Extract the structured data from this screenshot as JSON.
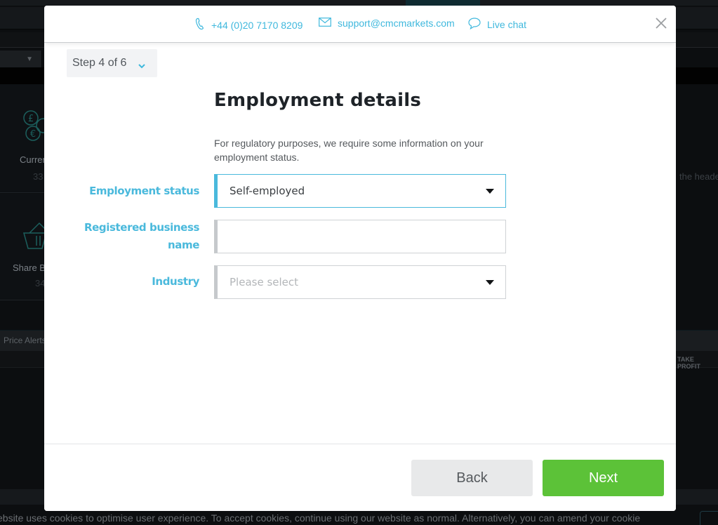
{
  "background": {
    "tiles": [
      {
        "icon": "currency-coins-icon",
        "label": "Curren",
        "count": "33"
      },
      {
        "icon": "share-basket-icon",
        "label": "Share Ba",
        "count": "34"
      }
    ],
    "alerts_tab": "Price Alerts",
    "column_header_right": "TAKE PROFIT",
    "right_hint_text": "the heade",
    "cookie_notice": "ebsite uses cookies to optimise user experience. To accept cookies, continue using our website as normal. Alternatively, you can amend your cookie"
  },
  "modal": {
    "header": {
      "phone": "+44 (0)20 7170 8209",
      "email": "support@cmcmarkets.com",
      "live_chat": "Live chat"
    },
    "step": {
      "label": "Step 4 of 6",
      "current": 4,
      "total": 6
    },
    "title": "Employment details",
    "description": "For regulatory purposes, we require some information on your employment status.",
    "fields": [
      {
        "label": "Employment status",
        "type": "select",
        "value": "Self-employed",
        "placeholder": ""
      },
      {
        "label": "Registered business name",
        "type": "text",
        "value": "",
        "placeholder": ""
      },
      {
        "label": "Industry",
        "type": "select",
        "value": "",
        "placeholder": "Please select"
      }
    ],
    "footer": {
      "back_label": "Back",
      "next_label": "Next"
    }
  },
  "colors": {
    "accent": "#4ab9dc",
    "link": "#3fb8dd",
    "primary_button": "#5cc238",
    "secondary_button": "#e8e9ea",
    "title_text": "#1e2328"
  }
}
